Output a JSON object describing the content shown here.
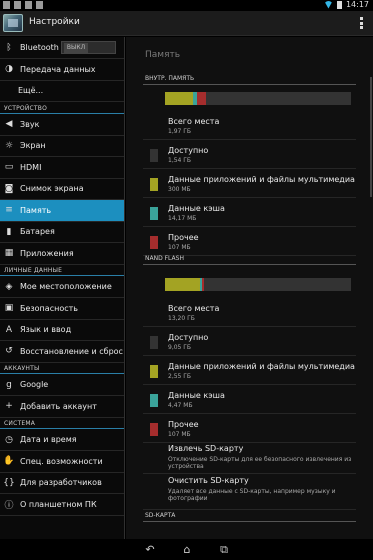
{
  "status_bar": {
    "time": "14:17"
  },
  "action_bar": {
    "title": "Настройки"
  },
  "sidebar": {
    "items": [
      {
        "name": "bluetooth",
        "label": "Bluetooth",
        "icon": "bluetooth-icon",
        "toggle": "ВЫКЛ"
      },
      {
        "name": "data-transfer",
        "label": "Передача данных",
        "icon": "data-usage-icon"
      },
      {
        "name": "more",
        "label": "Ещё..."
      }
    ],
    "sections": [
      {
        "label": "УСТРОЙСТВО",
        "items": [
          {
            "name": "sound",
            "label": "Звук",
            "icon": "volume-icon"
          },
          {
            "name": "screen",
            "label": "Экран",
            "icon": "display-icon"
          },
          {
            "name": "hdmi",
            "label": "HDMI",
            "icon": "hdmi-icon"
          },
          {
            "name": "screenshot",
            "label": "Снимок экрана",
            "icon": "camera-icon"
          },
          {
            "name": "memory",
            "label": "Память",
            "icon": "storage-icon",
            "selected": true
          },
          {
            "name": "battery",
            "label": "Батарея",
            "icon": "battery-icon"
          },
          {
            "name": "apps",
            "label": "Приложения",
            "icon": "apps-icon"
          }
        ]
      },
      {
        "label": "ЛИЧНЫЕ ДАННЫЕ",
        "items": [
          {
            "name": "location",
            "label": "Мое местоположение",
            "icon": "location-icon"
          },
          {
            "name": "security",
            "label": "Безопасность",
            "icon": "lock-icon"
          },
          {
            "name": "language",
            "label": "Язык и ввод",
            "icon": "keyboard-icon"
          },
          {
            "name": "backup",
            "label": "Восстановление и сброс",
            "icon": "restore-icon"
          }
        ]
      },
      {
        "label": "АККАУНТЫ",
        "items": [
          {
            "name": "google",
            "label": "Google",
            "icon": "google-icon"
          },
          {
            "name": "add-account",
            "label": "Добавить аккаунт",
            "icon": "plus-icon"
          }
        ]
      },
      {
        "label": "СИСТЕМА",
        "items": [
          {
            "name": "datetime",
            "label": "Дата и время",
            "icon": "clock-icon"
          },
          {
            "name": "accessibility",
            "label": "Спец. возможности",
            "icon": "hand-icon"
          },
          {
            "name": "developer",
            "label": "Для разработчиков",
            "icon": "code-icon"
          },
          {
            "name": "about",
            "label": "О планшетном ПК",
            "icon": "info-icon"
          }
        ]
      }
    ]
  },
  "storage": {
    "title": "Память",
    "internal": {
      "label": "ВНУТР. ПАМЯТЬ",
      "bar": {
        "apps": 0.15,
        "cache": 0.02,
        "other": 0.05
      },
      "items": [
        {
          "name": "total",
          "label": "Всего места",
          "value": "1,97 ГБ",
          "color": ""
        },
        {
          "name": "available",
          "label": "Доступно",
          "value": "1,54 ГБ",
          "color": "#333333"
        },
        {
          "name": "apps",
          "label": "Данные приложений и файлы мультимедиа",
          "value": "300 МБ",
          "color": "#a3a323"
        },
        {
          "name": "cache",
          "label": "Данные кэша",
          "value": "14,17 МБ",
          "color": "#3aa39a"
        },
        {
          "name": "other",
          "label": "Прочее",
          "value": "107 МБ",
          "color": "#a52d2d"
        }
      ]
    },
    "nand": {
      "label": "NAND FLASH",
      "bar": {
        "apps": 0.19,
        "cache": 0.01,
        "other": 0.01
      },
      "items": [
        {
          "name": "total",
          "label": "Всего места",
          "value": "13,20 ГБ",
          "color": ""
        },
        {
          "name": "available",
          "label": "Доступно",
          "value": "9,05 ГБ",
          "color": "#333333"
        },
        {
          "name": "apps",
          "label": "Данные приложений и файлы мультимедиа",
          "value": "2,55 ГБ",
          "color": "#a3a323"
        },
        {
          "name": "cache",
          "label": "Данные кэша",
          "value": "4,47 МБ",
          "color": "#3aa39a"
        },
        {
          "name": "other",
          "label": "Прочее",
          "value": "107 МБ",
          "color": "#a52d2d"
        }
      ]
    },
    "actions": [
      {
        "name": "eject-sd",
        "title": "Извлечь SD-карту",
        "desc": "Отключение SD-карты для ее безопасного извлечения из устройства"
      },
      {
        "name": "erase-sd",
        "title": "Очистить SD-карту",
        "desc": "Удаляет все данные с SD-карты, например музыку и фотографии"
      }
    ],
    "sd_label": "SD-КАРТА"
  }
}
